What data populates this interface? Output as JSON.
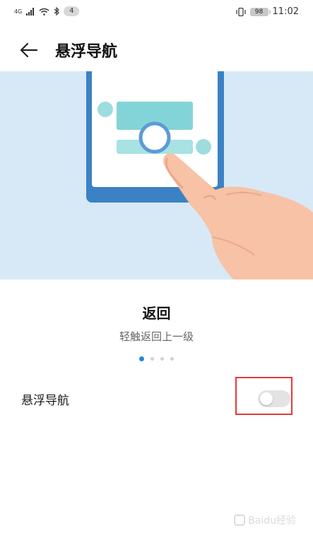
{
  "status_bar": {
    "network": "4G",
    "notification_count": "4",
    "battery": "98",
    "time": "11:02"
  },
  "header": {
    "title": "悬浮导航"
  },
  "carousel": {
    "title": "返回",
    "subtitle": "轻触返回上一级",
    "pages": 4,
    "active_page": 1
  },
  "settings": {
    "floating_nav_label": "悬浮导航",
    "floating_nav_enabled": false
  },
  "colors": {
    "accent": "#1e88e5",
    "illustration_bg": "#d7e9f7",
    "highlight": "#e53935"
  },
  "watermark": {
    "text": "Baidu经验"
  }
}
